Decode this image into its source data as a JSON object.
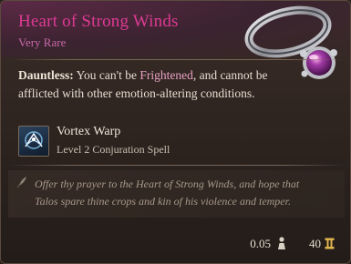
{
  "item": {
    "name": "Heart of Strong Winds",
    "rarity": "Very Rare",
    "icon": "ring-icon"
  },
  "description": {
    "condition": "Dauntless:",
    "text_before": " You can't be ",
    "keyword": "Frightened",
    "text_after": ", and cannot be afflicted with other emotion-altering conditions."
  },
  "spell": {
    "icon": "vortex-warp-icon",
    "name": "Vortex Warp",
    "detail": "Level 2 Conjuration Spell"
  },
  "flavor": {
    "icon": "quill-icon",
    "text": "Offer thy prayer to the Heart of Strong Winds, and hope that Talos spare thine crops and kin of his violence and temper."
  },
  "footer": {
    "weight": "0.05",
    "weight_icon": "weight-icon",
    "value": "40",
    "value_icon": "gold-coin-icon"
  },
  "colors": {
    "title": "#dd3a93",
    "rarity": "#c86aa6",
    "keyword": "#e7a0c4",
    "background": "#2b221e"
  }
}
